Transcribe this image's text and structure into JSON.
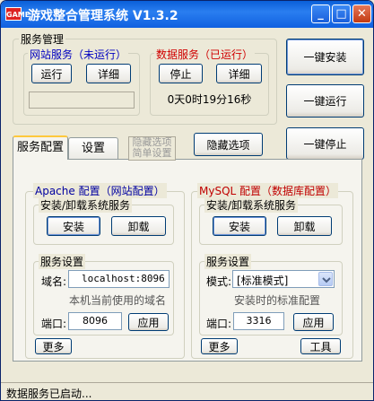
{
  "window": {
    "title": "游戏整合管理系统  V1.3.2",
    "icon_text": "GAME",
    "min": "_",
    "max": "□",
    "close": "✕"
  },
  "service_mgmt": {
    "label": "服务管理",
    "web": {
      "label": "网站服务（未运行）",
      "run": "运行",
      "detail": "详细",
      "status": ""
    },
    "db": {
      "label": "数据服务（已运行）",
      "stop": "停止",
      "detail": "详细",
      "uptime": "0天0时19分16秒"
    }
  },
  "right_buttons": {
    "install_all": "一键安装",
    "run_all": "一键运行",
    "stop_all": "一键停止"
  },
  "tabs": {
    "items": [
      "服务配置",
      "设置"
    ],
    "hidden_tab": "隐藏选项\n简单设置",
    "hide_options": "隐藏选项"
  },
  "apache": {
    "label": "Apache 配置（网站配置）",
    "install_group": "安装/卸载系统服务",
    "install": "安装",
    "uninstall": "卸载",
    "settings_group": "服务设置",
    "domain_label": "域名:",
    "domain_value": "localhost:8096",
    "domain_hint": "本机当前使用的域名",
    "port_label": "端口:",
    "port_value": "8096",
    "apply": "应用",
    "more": "更多"
  },
  "mysql": {
    "label": "MySQL 配置（数据库配置）",
    "install_group": "安装/卸载系统服务",
    "install": "安装",
    "uninstall": "卸载",
    "settings_group": "服务设置",
    "mode_label": "模式:",
    "mode_value": "[标准模式]",
    "mode_hint": "安装时的标准配置",
    "port_label": "端口:",
    "port_value": "3316",
    "apply": "应用",
    "more": "更多",
    "tools": "工具"
  },
  "status_bar": {
    "text": "数据服务已启动..."
  },
  "colors": {
    "title_blue": "#1060e0",
    "web_label": "#0000c0",
    "db_label": "#d00000",
    "apache_label": "#0000a0",
    "mysql_label": "#c00000"
  }
}
